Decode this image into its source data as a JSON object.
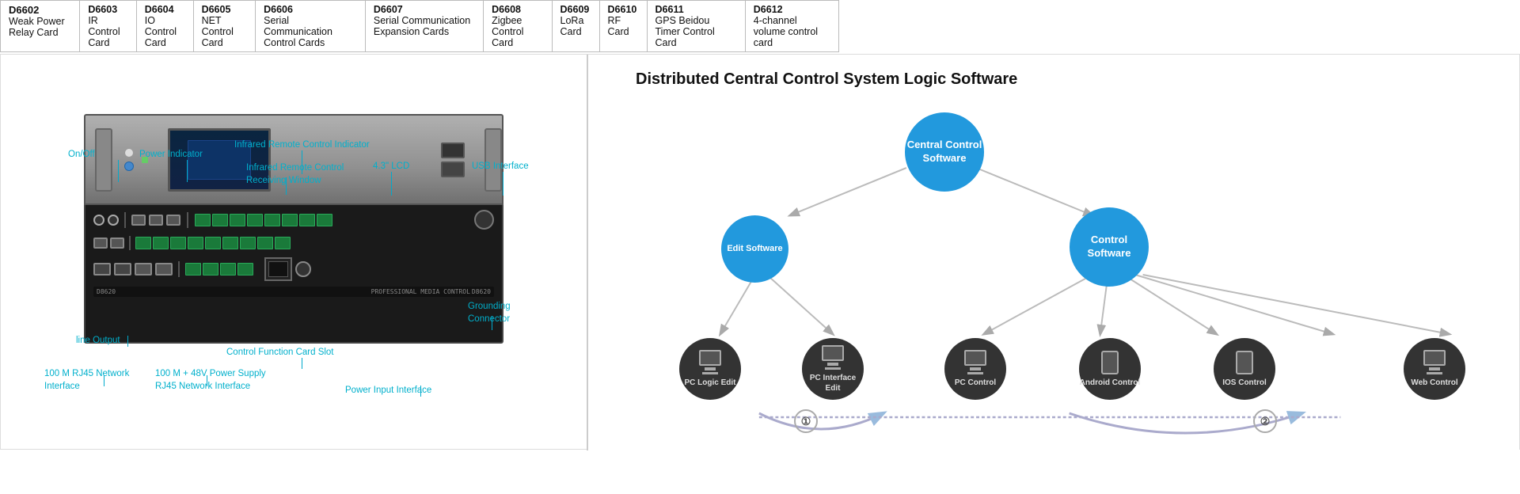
{
  "top_table": {
    "cards": [
      {
        "code": "D6602",
        "name": "Weak Power Relay Card"
      },
      {
        "code": "D6603",
        "name": "IR Control Card"
      },
      {
        "code": "D6604",
        "name": "IO Control Card"
      },
      {
        "code": "D6605",
        "name": "NET Control Card"
      },
      {
        "code": "D6606",
        "name": "Serial Communication Control Cards"
      },
      {
        "code": "D6607",
        "name": "Serial Communication Expansion Cards"
      },
      {
        "code": "D6608",
        "name": "Zigbee Control Card"
      },
      {
        "code": "D6609",
        "name": "LoRa Card"
      },
      {
        "code": "D6610",
        "name": "RF Card"
      },
      {
        "code": "D6611",
        "name": "GPS Beidou Timer Control Card"
      },
      {
        "code": "D6612",
        "name": "4-channel volume control card"
      }
    ]
  },
  "left_diagram": {
    "labels": {
      "on_off": "On/Off",
      "power_indicator": "Power Indicator",
      "infrared_indicator": "Infrared Remote Control Indicator",
      "infrared_window": "Infrared Remote Control\nReceiving Window",
      "lcd_43": "4.3\" LCD",
      "usb_interface": "USB Interface",
      "grounding_connector": "Grounding\nConnector",
      "line_output": "line Output",
      "network_100m": "100 M RJ45 Network\nInterface",
      "power_supply": "100 M + 48V Power Supply\nRJ45 Network Interface",
      "control_card_slot": "Control Function Card Slot",
      "power_input": "Power Input Interface"
    }
  },
  "right_diagram": {
    "title": "Distributed Central Control System Logic Software",
    "nodes": {
      "central_control": "Central\nControl\nSoftware",
      "edit_software": "Edit Software",
      "control_software": "Control\nSoftware",
      "pc_logic_edit": "PC Logic\nEdit",
      "pc_interface_edit": "PC Interface\nEdit",
      "pc_control": "PC Control",
      "android_control": "Android\nControl",
      "ios_control": "IOS Control",
      "web_control": "Web Control"
    },
    "circle_numbers": [
      "①",
      "②"
    ]
  }
}
